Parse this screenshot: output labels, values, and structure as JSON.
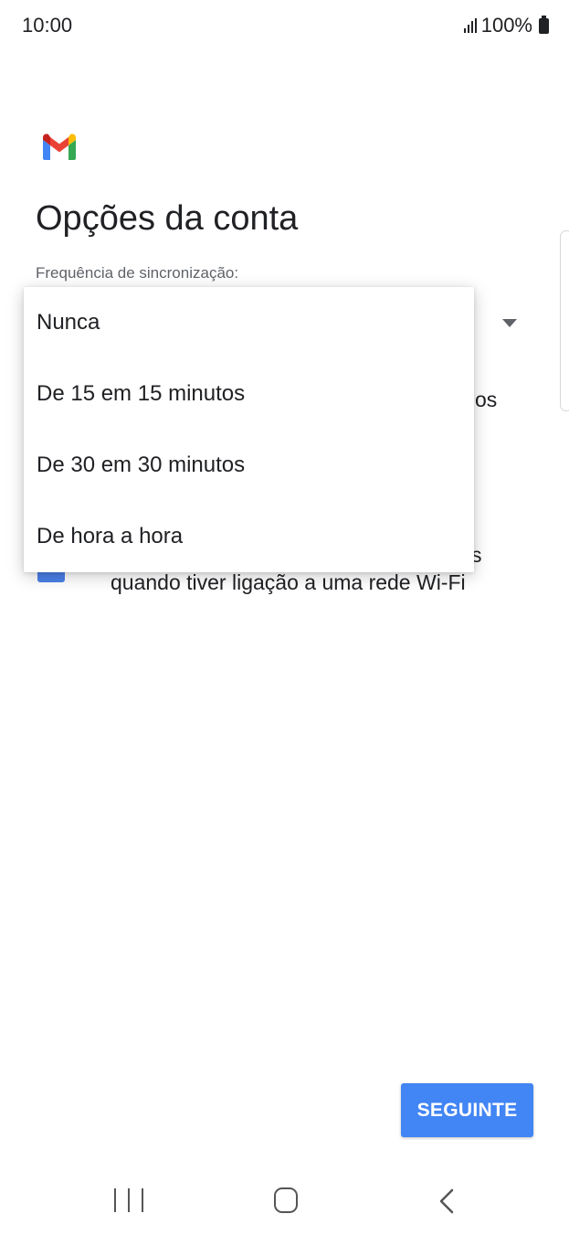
{
  "status_bar": {
    "time": "10:00",
    "battery": "100%"
  },
  "page": {
    "title": "Opções da conta",
    "sync_label": "Frequência de sincronização:",
    "partial_text_right": "os",
    "partial_text_right_2": "s",
    "wifi_option_text": "quando tiver ligação a uma rede Wi-Fi"
  },
  "dropdown": {
    "options": [
      {
        "label": "Nunca"
      },
      {
        "label": "De 15 em 15 minutos"
      },
      {
        "label": "De 30 em 30 minutos"
      },
      {
        "label": "De hora a hora"
      }
    ]
  },
  "buttons": {
    "next_label": "SEGUINTE"
  },
  "icons": {
    "logo": "gmail-logo-icon",
    "signal": "signal-icon",
    "battery": "battery-icon",
    "dropdown": "dropdown-arrow-icon",
    "recents": "recents-icon",
    "home": "home-icon",
    "back": "back-icon"
  },
  "colors": {
    "primary": "#4285f4",
    "checkbox": "#4a80e8"
  }
}
